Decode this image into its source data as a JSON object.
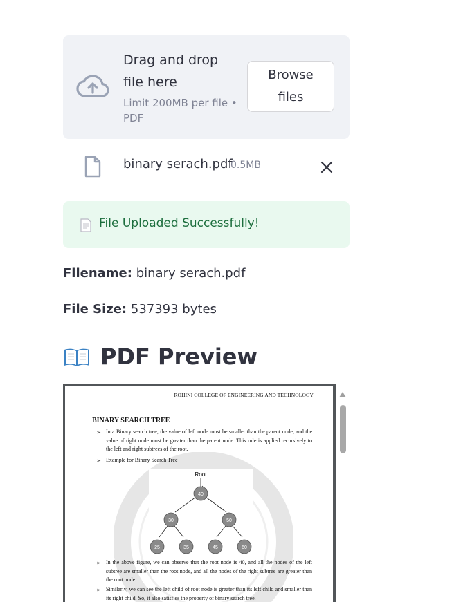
{
  "uploader": {
    "drop_label": "Drag and drop file here",
    "limit_label": "Limit 200MB per file • PDF",
    "browse_label": "Browse files",
    "file_name": "binary serach.pdf",
    "file_size": "0.5MB"
  },
  "alert": {
    "message": "File Uploaded Successfully!",
    "color": "#1c6e3d",
    "background": "#e9f9ef"
  },
  "info": {
    "filename_label": "Filename:",
    "filename_value": "binary serach.pdf",
    "filesize_label": "File Size:",
    "filesize_value": "537393 bytes"
  },
  "preview": {
    "heading": "PDF Preview",
    "heading_icon": "open-book-icon",
    "pdf": {
      "header": "ROHINI COLLEGE OF ENGINEERING AND TECHNOLOGY",
      "title": "BINARY SEARCH TREE",
      "bullets": [
        "In a Binary search tree, the value of left node must be smaller than the parent node, and the value of right node must be greater than the parent node. This rule is applied recursively to the left and right subtrees of the root.",
        "Example for Binary Search Tree",
        "In the above figure, we can observe that the root node is 40, and all the nodes of the left subtree are smaller than the root node, and all the nodes of the right subtree are greater than the root node.",
        "Similarly, we can see the left child of root node is greater than its left child and smaller than its right child. So, it also satisfies the property of binary search tree."
      ],
      "tree": {
        "root_label": "Root",
        "nodes": [
          "40",
          "30",
          "50",
          "25",
          "35",
          "45",
          "60"
        ]
      },
      "watermark": "ROHINI COLLEGE OF ENGINEERING AND TECHNOLOGY"
    }
  }
}
